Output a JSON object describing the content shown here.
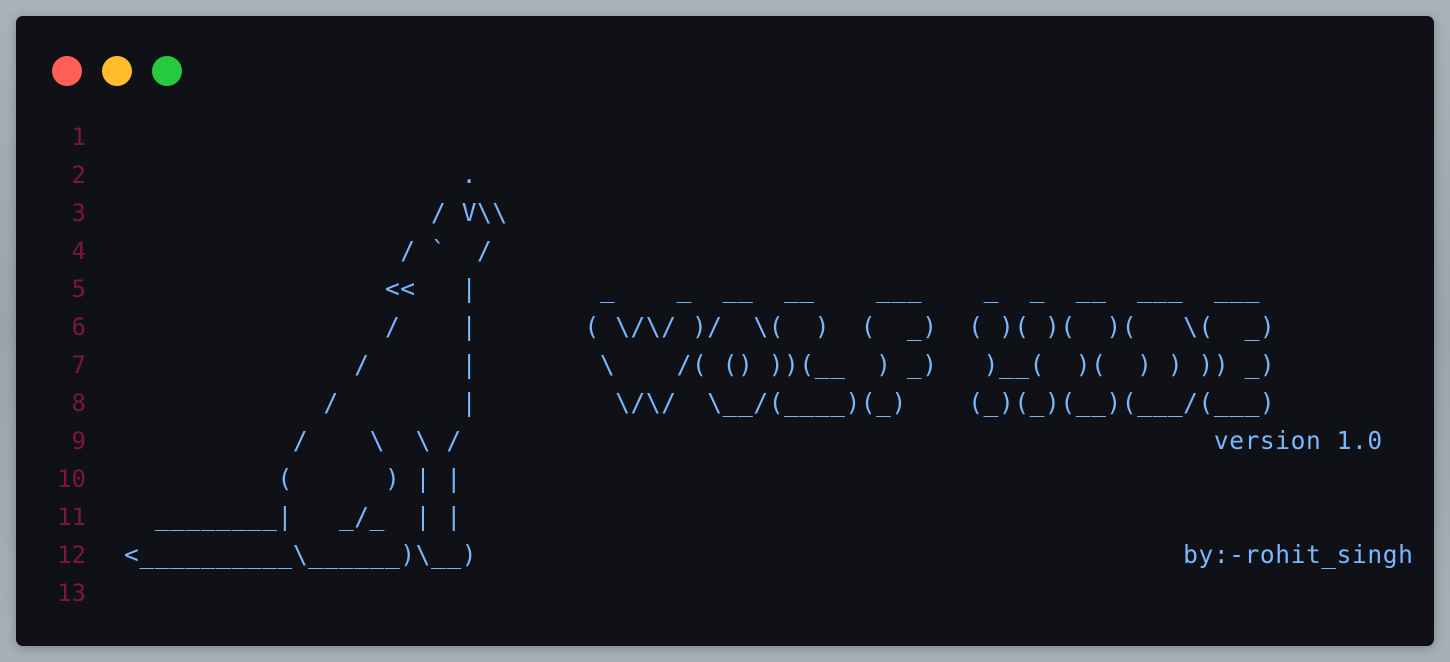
{
  "window": {
    "buttons": [
      {
        "name": "close",
        "color": "#ff5f56"
      },
      {
        "name": "minimize",
        "color": "#ffbd2e"
      },
      {
        "name": "maximize",
        "color": "#27c93f"
      }
    ]
  },
  "editor": {
    "line_number_color": "#7d1736",
    "text_color": "#79b8ff",
    "lines": [
      {
        "num": "1",
        "text": ""
      },
      {
        "num": "2",
        "text": "                      ."
      },
      {
        "num": "3",
        "text": "                    / V\\\\"
      },
      {
        "num": "4",
        "text": "                  / `  /"
      },
      {
        "num": "5",
        "text": "                 <<   |        _    _  __  __    ___    _  _  __  ___  ___"
      },
      {
        "num": "6",
        "text": "                 /    |       ( \\/\\/ )/  \\(  )  (  _)  ( )( )(  )(   \\(  _)"
      },
      {
        "num": "7",
        "text": "               /      |        \\    /( () ))(__  ) _)   )__(  )(  ) ) )) _)"
      },
      {
        "num": "8",
        "text": "             /        |         \\/\\/  \\__/(____)(_)    (_)(_)(__)(___/(___)"
      },
      {
        "num": "9",
        "text": "           /    \\  \\ /                                                 version 1.0"
      },
      {
        "num": "10",
        "text": "          (      ) | |"
      },
      {
        "num": "11",
        "text": "  ________|   _/_  | |"
      },
      {
        "num": "12",
        "text": "<__________\\______)\\__)                                              by:-rohit_singh"
      },
      {
        "num": "13",
        "text": ""
      }
    ]
  }
}
